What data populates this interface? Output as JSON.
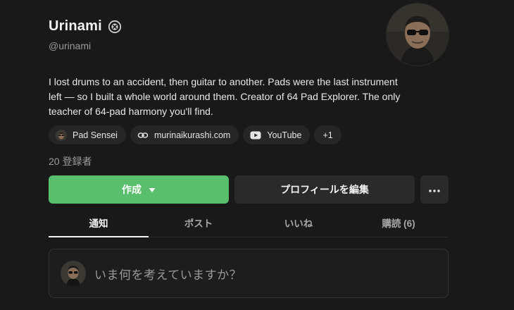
{
  "profile": {
    "name": "Urinami",
    "handle": "@urinami",
    "bio_lines": [
      "I lost drums to an accident, then guitar to another. Pads were the last instrument",
      "left — so I built a whole world around them. Creator of 64 Pad Explorer. The only",
      "teacher of 64-pad harmony you'll find."
    ],
    "subscribers": "20 登録者"
  },
  "links": [
    {
      "label": "Pad Sensei",
      "icon": "avatar-icon"
    },
    {
      "label": "murinaikurashi.com",
      "icon": "link-icon"
    },
    {
      "label": "YouTube",
      "icon": "youtube-icon"
    },
    {
      "label": "+1"
    }
  ],
  "actions": {
    "create_label": "作成",
    "edit_label": "プロフィールを編集"
  },
  "tabs": [
    {
      "label": "通知",
      "active": true
    },
    {
      "label": "ポスト"
    },
    {
      "label": "いいね"
    },
    {
      "label": "購読 (6)"
    }
  ],
  "composer": {
    "placeholder": "いま何を考えていますか？"
  },
  "colors": {
    "background": "#191919",
    "accent_green": "#59bf6d",
    "surface": "#2a2a2a"
  }
}
